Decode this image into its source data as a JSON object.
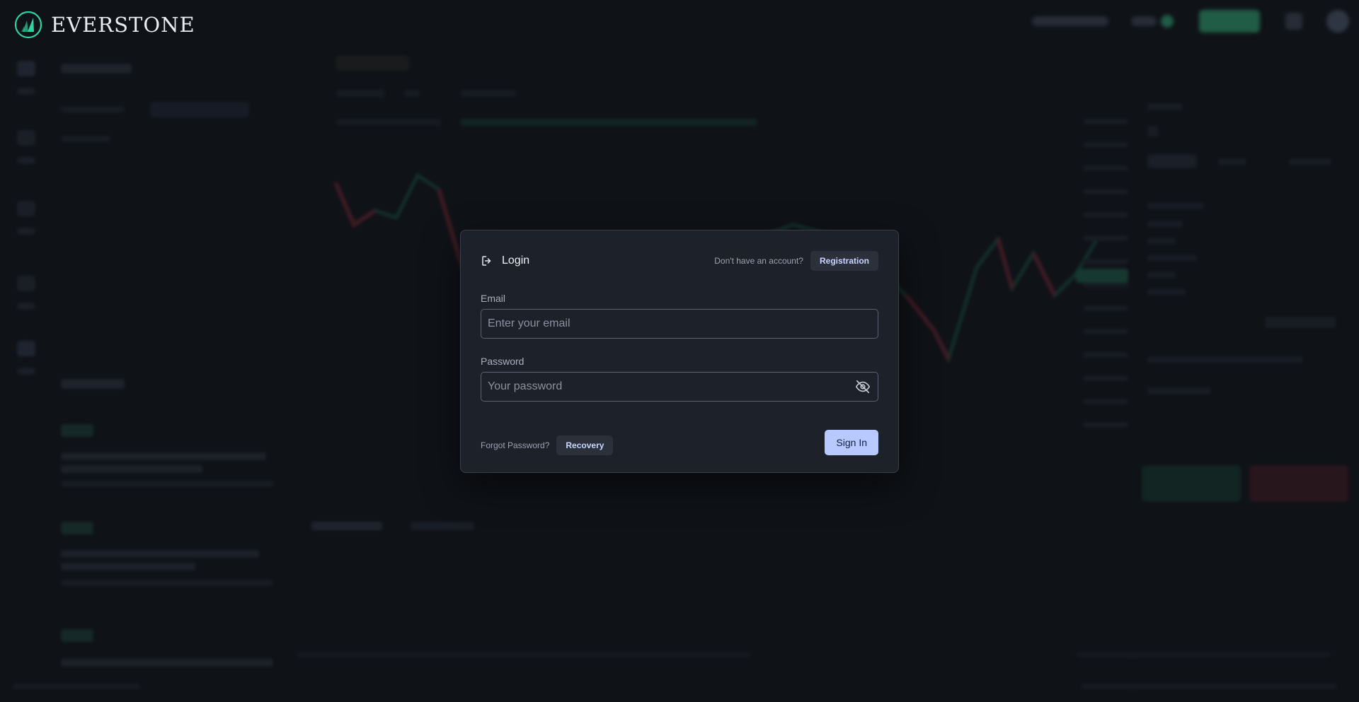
{
  "brand": {
    "name": "EVERSTONE"
  },
  "login": {
    "title": "Login",
    "no_account_text": "Don't have an account?",
    "registration_label": "Registration",
    "email": {
      "label": "Email",
      "placeholder": "Enter your email",
      "value": ""
    },
    "password": {
      "label": "Password",
      "placeholder": "Your password",
      "value": ""
    },
    "forgot_text": "Forgot Password?",
    "recovery_label": "Recovery",
    "signin_label": "Sign In"
  },
  "colors": {
    "background": "#12151c",
    "modal_bg": "#1d212a",
    "accent_primary": "#b7c9ff",
    "brand_green": "#2fd3a0",
    "chart_up": "#26a17a",
    "chart_down": "#c0394b"
  },
  "icons": {
    "login": "login-arrow-icon",
    "password_toggle": "eye-off-icon"
  }
}
